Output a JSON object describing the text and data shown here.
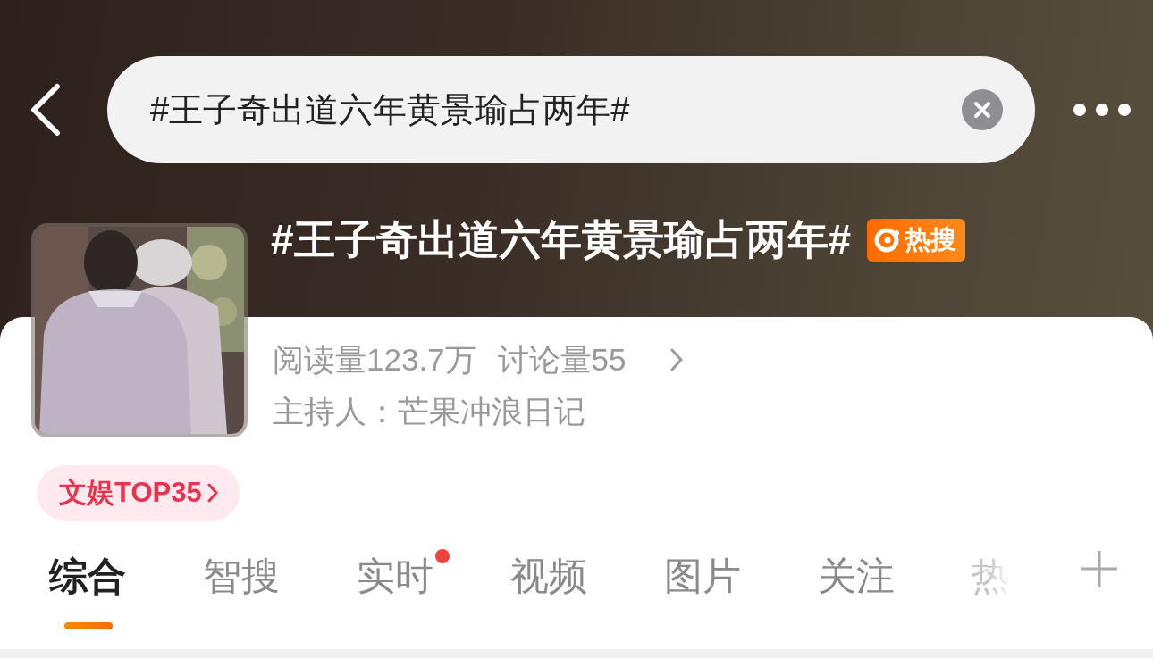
{
  "search": {
    "value": "#王子奇出道六年黄景瑜占两年#"
  },
  "topic": {
    "title": "#王子奇出道六年黄景瑜占两年#",
    "badge": "热搜",
    "reads": "阅读量123.7万",
    "discussions": "讨论量55",
    "host": "主持人：芒果冲浪日记",
    "rank": "文娱TOP35"
  },
  "tabs": [
    {
      "label": "综合",
      "selected": true,
      "dot": false
    },
    {
      "label": "智搜",
      "selected": false,
      "dot": false
    },
    {
      "label": "实时",
      "selected": false,
      "dot": true
    },
    {
      "label": "视频",
      "selected": false,
      "dot": false
    },
    {
      "label": "图片",
      "selected": false,
      "dot": false
    },
    {
      "label": "关注",
      "selected": false,
      "dot": false
    },
    {
      "label": "热",
      "selected": false,
      "dot": false
    }
  ]
}
